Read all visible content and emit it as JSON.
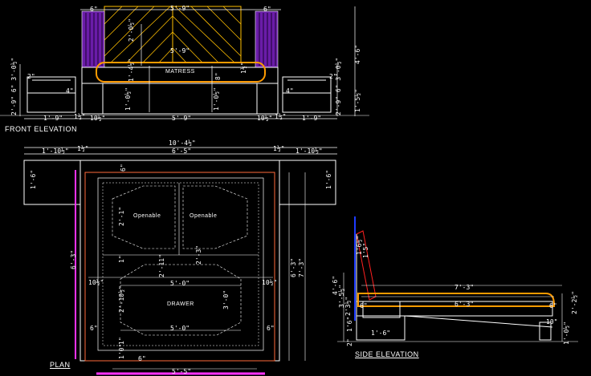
{
  "views": {
    "front_title": "FRONT ELEVATION",
    "plan_title": "PLAN",
    "side_title": "SIDE ELEVATION"
  },
  "labels": {
    "matress": "MATRESS",
    "openable_left": "Openable",
    "openable_right": "Openable",
    "drawer": "DRAWER"
  },
  "front_dims": {
    "top_left": "6\"",
    "top_center": "5'-9\"",
    "top_right": "6\"",
    "head_h": "2'-0½\"",
    "inner": "5'-9\"",
    "bed_h": "1'-4½\"",
    "mid_left": "1'-0½\"",
    "mid_right": "1'-0½\"",
    "small_a": "8\"",
    "small_b": "1½\"",
    "left_stack": "2'-9\" 6\" 3'-0½\"",
    "right_stack": "2'-9\" 6\" 3'-0½\"",
    "nt_top_l": "2\"",
    "nt_top_r": "2\"",
    "nt_inner_l": "4\"",
    "nt_inner_r": "4\"",
    "tall_right": "4'-6\"",
    "side_right": "1'-5½\"",
    "bot_1": "1'-9\"",
    "bot_2": "1½\"",
    "bot_3": "10½\"",
    "bot_4": "5'-9\"",
    "bot_5": "10½\"",
    "bot_6": "1½\"",
    "bot_7": "1'-9\""
  },
  "plan_dims": {
    "overall": "10'-4½\"",
    "l1": "1'-10½\"",
    "l2": "1½\"",
    "inner": "6'-5\"",
    "r2": "1½\"",
    "r1": "1'-10½\"",
    "nt_left": "1'-6\"",
    "nt_right": "1'-6\"",
    "top_gap": "6\"",
    "len_left": "6'-3\"",
    "open_h": "2'-1\"",
    "mid_gap": "1\"",
    "mid_a": "2'-11\"",
    "mid_b": "2'-3\"",
    "side_l": "10½\"",
    "side_r": "10½\"",
    "drawer_w": "5'-0\"",
    "drawer_h1": "2'-10½\"",
    "drawer_h2": "3'-0\"",
    "right_a": "6'-3\"",
    "right_b": "7'-3\"",
    "bottom_l": "6\"",
    "bottom_c": "5'-0\"",
    "bottom_r": "6\"",
    "bottom_gap": "1\"",
    "foot_l": "1'0\"",
    "foot_c": "6\"",
    "bottom_overall": "5'-5\""
  },
  "side_dims": {
    "top_len": "7'-3\"",
    "inner_len": "6'-3\"",
    "head_a": "1'6½\"",
    "head_b": "1'5\"",
    "left_a": "4'-6\"",
    "left_b": "3'-5½\"",
    "left_c": "2'3½\"",
    "left_d": "1'6\"",
    "left_e": "2\"",
    "small": "6\"",
    "right_a": "6\"",
    "right_b": "10\"",
    "right_c": "1'-0½\"",
    "right_d": "2'-2½\"",
    "foot": "1'-6\""
  },
  "colors": {
    "background": "#000000",
    "lines": "#ffffff",
    "headboard": "#ffbf00",
    "panel": "#6a1ca8",
    "mattress": "#ff9b00",
    "plan_frame": "#ff6a3a",
    "magenta": "#ff32ff",
    "blue": "#1e3cff",
    "red": "#ff2020"
  }
}
